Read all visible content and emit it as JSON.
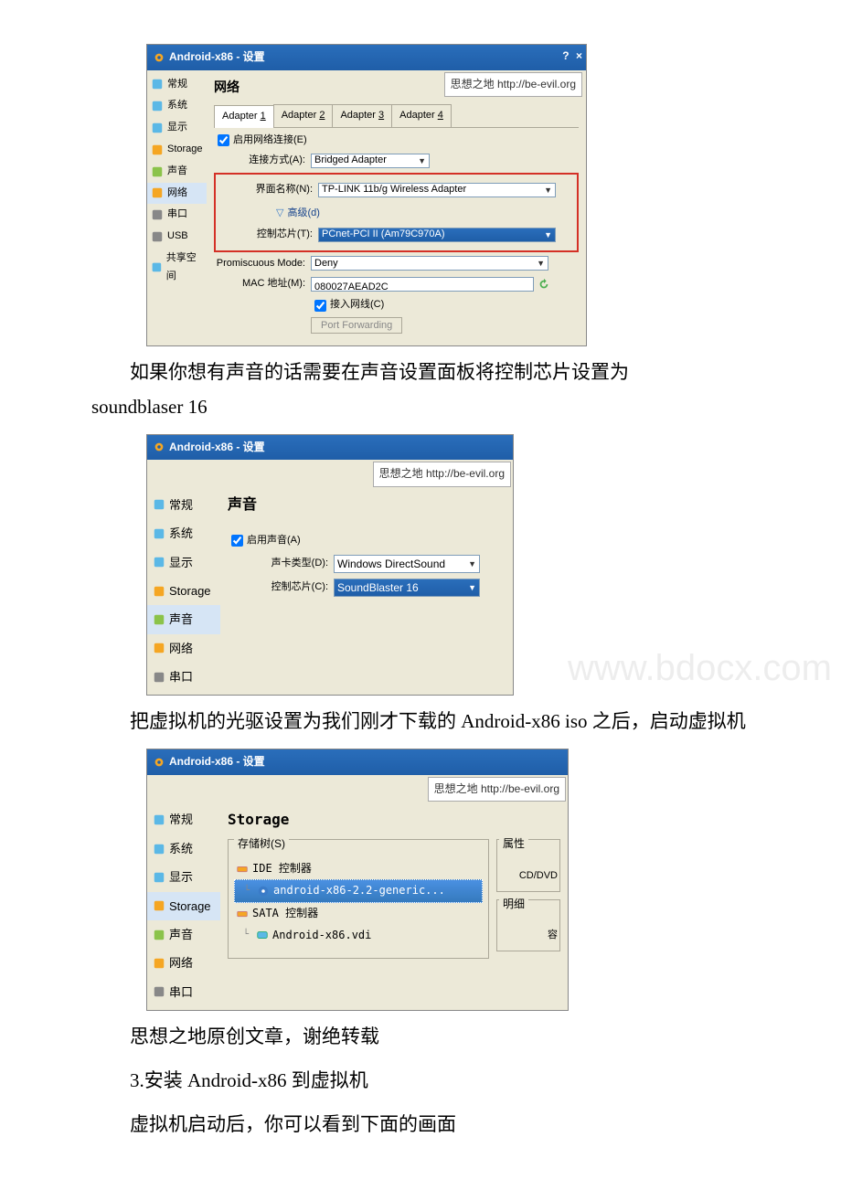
{
  "shot1": {
    "title": "Android-x86 - 设置",
    "watermark": "思想之地 http://be-evil.org",
    "help": "?",
    "close": "×",
    "sidebar": [
      {
        "label": "常规",
        "icon": "monitor"
      },
      {
        "label": "系统",
        "icon": "chip"
      },
      {
        "label": "显示",
        "icon": "display"
      },
      {
        "label": "Storage",
        "icon": "disk"
      },
      {
        "label": "声音",
        "icon": "audio"
      },
      {
        "label": "网络",
        "icon": "network",
        "active": true
      },
      {
        "label": "串口",
        "icon": "serial"
      },
      {
        "label": "USB",
        "icon": "usb"
      },
      {
        "label": "共享空间",
        "icon": "folder"
      }
    ],
    "section": "网络",
    "tabs": [
      "Adapter 1",
      "Adapter 2",
      "Adapter 3",
      "Adapter 4"
    ],
    "enable_label": "启用网络连接(E)",
    "rows": {
      "attach_label": "连接方式(A):",
      "attach_value": "Bridged Adapter",
      "ifname_label": "界面名称(N):",
      "ifname_value": "TP-LINK 11b/g Wireless Adapter",
      "advanced": "高级(d)",
      "chip_label": "控制芯片(T):",
      "chip_value": "PCnet-PCI II (Am79C970A)",
      "prom_label": "Promiscuous Mode:",
      "prom_value": "Deny",
      "mac_label": "MAC 地址(M):",
      "mac_value": "080027AEAD2C",
      "cable_label": "接入网线(C)",
      "port_btn": "Port Forwarding"
    }
  },
  "para1_a": "如果你想有声音的话需要在声音设置面板将控制芯片设置为",
  "para1_b": "soundblaser 16",
  "shot2": {
    "title": "Android-x86 - 设置",
    "watermark": "思想之地 http://be-evil.org",
    "faded_url": "www.bdocx.com",
    "sidebar": [
      {
        "label": "常规",
        "icon": "monitor"
      },
      {
        "label": "系统",
        "icon": "chip"
      },
      {
        "label": "显示",
        "icon": "display"
      },
      {
        "label": "Storage",
        "icon": "disk"
      },
      {
        "label": "声音",
        "icon": "audio",
        "active": true
      },
      {
        "label": "网络",
        "icon": "network"
      },
      {
        "label": "串口",
        "icon": "serial"
      }
    ],
    "section": "声音",
    "enable_label": "启用声音(A)",
    "type_label": "声卡类型(D):",
    "type_value": "Windows DirectSound",
    "chip_label": "控制芯片(C):",
    "chip_value": "SoundBlaster 16"
  },
  "para2": "把虚拟机的光驱设置为我们刚才下载的 Android-x86 iso 之后，启动虚拟机",
  "shot3": {
    "title": "Android-x86 - 设置",
    "watermark": "思想之地 http://be-evil.org",
    "sidebar": [
      {
        "label": "常规",
        "icon": "monitor"
      },
      {
        "label": "系统",
        "icon": "chip"
      },
      {
        "label": "显示",
        "icon": "display"
      },
      {
        "label": "Storage",
        "icon": "disk",
        "active": true
      },
      {
        "label": "声音",
        "icon": "audio"
      },
      {
        "label": "网络",
        "icon": "network"
      },
      {
        "label": "串口",
        "icon": "serial"
      }
    ],
    "section": "Storage",
    "tree_legend": "存储树(S)",
    "props_legend": "属性",
    "detail_legend": "明细",
    "tree": {
      "ide": "IDE 控制器",
      "iso": "android-x86-2.2-generic...",
      "sata": "SATA 控制器",
      "vdi": "Android-x86.vdi"
    },
    "prop1": "CD/DVD",
    "prop2": "容"
  },
  "para3": "思想之地原创文章，谢绝转载",
  "para4": "3.安装 Android-x86 到虚拟机",
  "para5": "虚拟机启动后，你可以看到下面的画面"
}
